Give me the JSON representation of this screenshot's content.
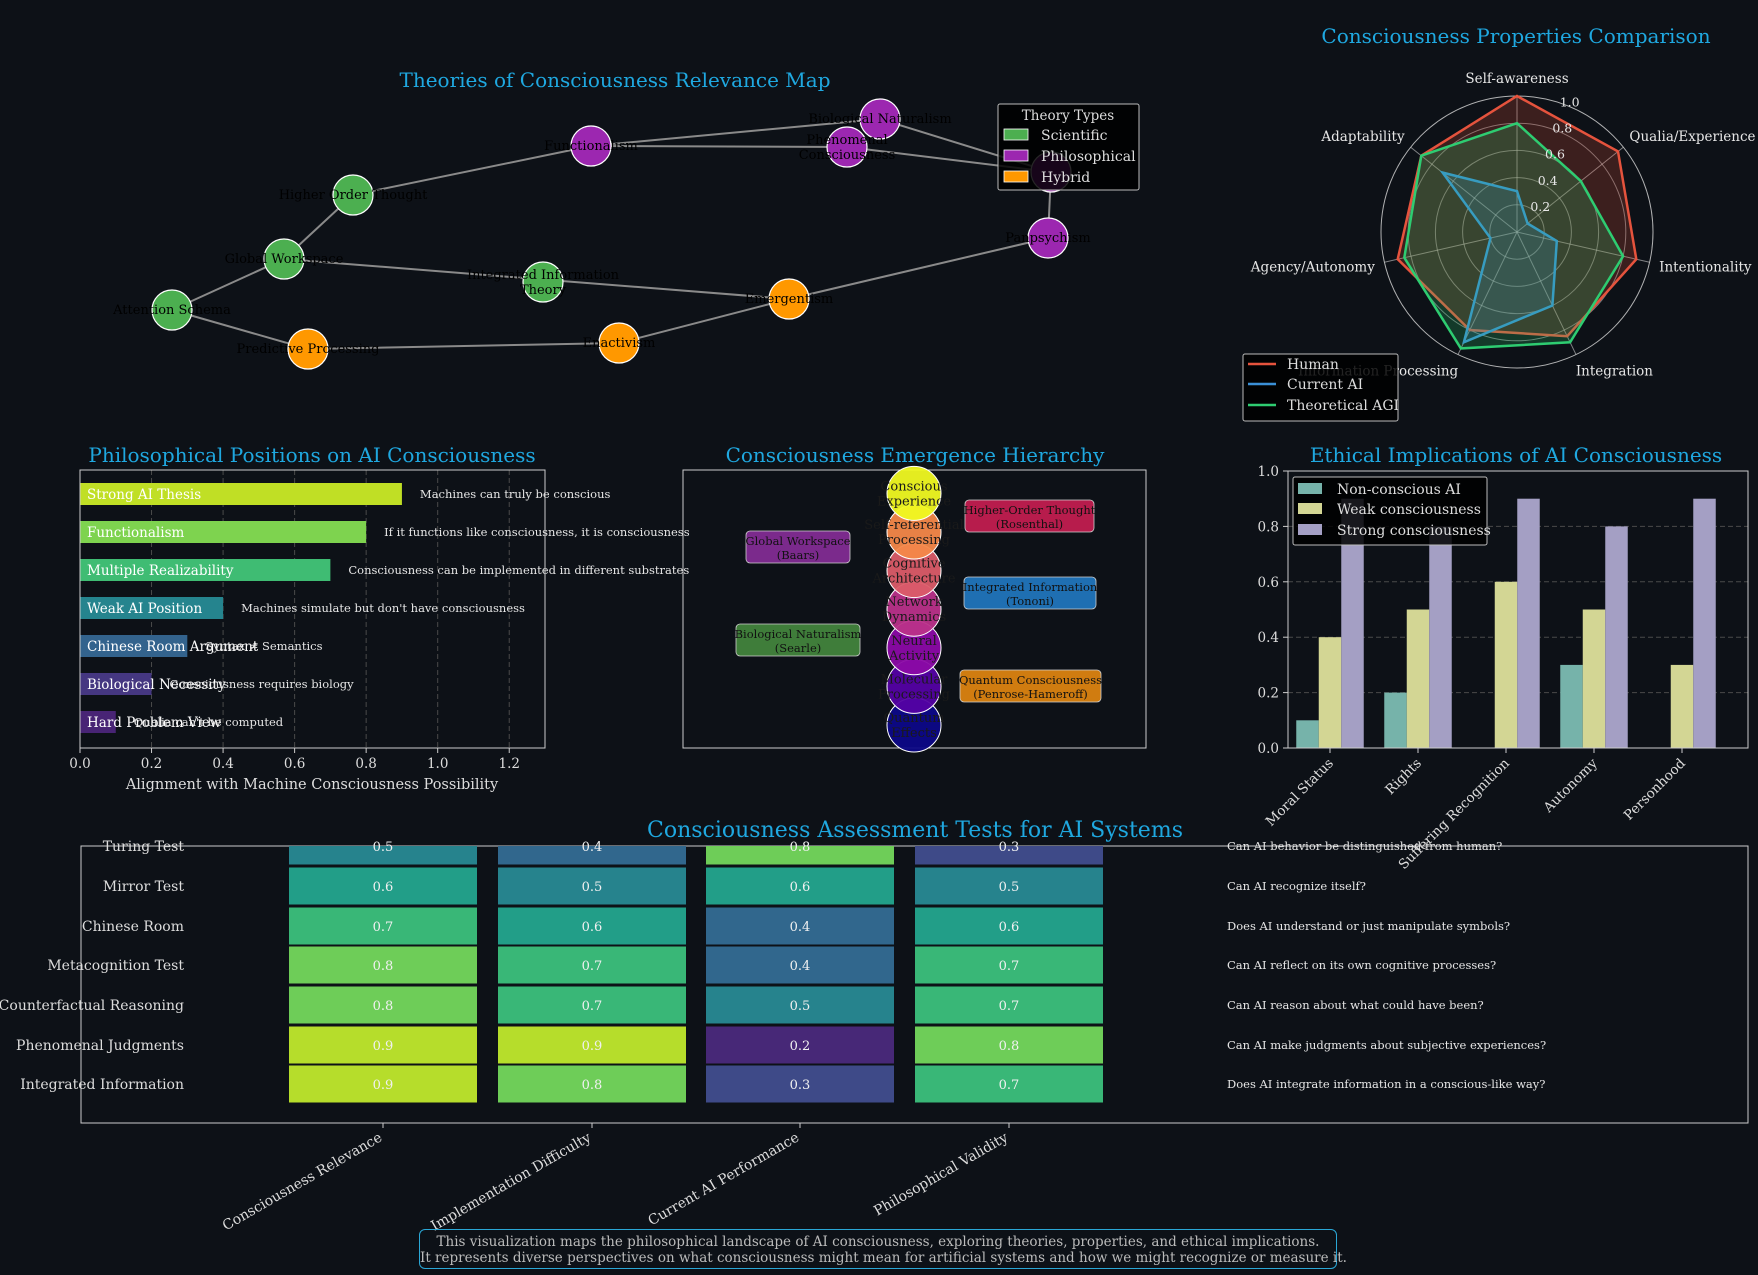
{
  "colors": {
    "background": "#0d1117",
    "title": "#1fa8e0",
    "scientific": "#4caf50",
    "philosophical": "#9c27b0",
    "hybrid": "#ff9800",
    "human": "#e5533d",
    "current_ai": "#3a8fd6",
    "theoretical_agi": "#2ecc71"
  },
  "footer": {
    "line1": "This visualization maps the philosophical landscape of AI consciousness, exploring theories, properties, and ethical implications.",
    "line2": "It represents diverse perspectives on what consciousness might mean for artificial systems and how we might recognize or measure it."
  },
  "chart_data": [
    {
      "id": "theory_map",
      "type": "network",
      "title": "Theories of Consciousness Relevance Map",
      "legend": {
        "title": "Theory Types",
        "placement": "top-right",
        "entries": [
          "Scientific",
          "Philosophical",
          "Hybrid"
        ]
      },
      "nodes": [
        {
          "label": "Attention Schema",
          "kind": "Scientific"
        },
        {
          "label": "Global Workspace",
          "kind": "Scientific"
        },
        {
          "label": "Higher Order Thought",
          "kind": "Scientific"
        },
        {
          "label": "Predictive Processing",
          "kind": "Hybrid"
        },
        {
          "label": "Functionalism",
          "kind": "Philosophical"
        },
        {
          "label": "Integrated Information Theory",
          "kind": "Scientific"
        },
        {
          "label": "Enactivism",
          "kind": "Hybrid"
        },
        {
          "label": "Emergentism",
          "kind": "Hybrid"
        },
        {
          "label": "Phenomenal Consciousness",
          "kind": "Philosophical"
        },
        {
          "label": "Biological Naturalism",
          "kind": "Philosophical"
        },
        {
          "label": "",
          "kind": "Philosophical"
        },
        {
          "label": "Panpsychism",
          "kind": "Philosophical"
        }
      ],
      "edges": [
        [
          0,
          1
        ],
        [
          1,
          2
        ],
        [
          2,
          4
        ],
        [
          4,
          9
        ],
        [
          4,
          8
        ],
        [
          0,
          3
        ],
        [
          3,
          6
        ],
        [
          6,
          7
        ],
        [
          1,
          7
        ],
        [
          7,
          11
        ],
        [
          11,
          10
        ],
        [
          9,
          10
        ],
        [
          8,
          10
        ]
      ]
    },
    {
      "id": "radar",
      "type": "radar",
      "title": "Consciousness Properties Comparison",
      "axes": [
        "Self-awareness",
        "Qualia/Experience",
        "Intentionality",
        "Integration",
        "Information Processing",
        "Agency/Autonomy",
        "Adaptability"
      ],
      "rticks": [
        "0.2",
        "0.4",
        "0.6",
        "0.8",
        "1.0"
      ],
      "rlim": [
        0,
        1
      ],
      "legend_placement": "lower-left",
      "series": [
        {
          "name": "Human",
          "values": [
            1.0,
            0.95,
            0.9,
            0.85,
            0.8,
            0.9,
            0.9
          ]
        },
        {
          "name": "Current AI",
          "values": [
            0.3,
            0.1,
            0.3,
            0.6,
            0.9,
            0.2,
            0.7
          ]
        },
        {
          "name": "Theoretical AGI",
          "values": [
            0.8,
            0.6,
            0.8,
            0.9,
            0.95,
            0.85,
            0.9
          ]
        }
      ]
    },
    {
      "id": "positions",
      "type": "bar",
      "orientation": "horizontal",
      "title": "Philosophical Positions on AI Consciousness",
      "xlabel": "Alignment with Machine Consciousness Possibility",
      "xlim": [
        0,
        1.3
      ],
      "xticks": [
        "0.0",
        "0.2",
        "0.4",
        "0.6",
        "0.8",
        "1.0",
        "1.2"
      ],
      "grid": true,
      "categories": [
        "Strong AI Thesis",
        "Functionalism",
        "Multiple Realizability",
        "Weak AI Position",
        "Chinese Room Argument",
        "Biological Necessity",
        "Hard Problem View"
      ],
      "values": [
        0.9,
        0.8,
        0.7,
        0.4,
        0.3,
        0.2,
        0.1
      ],
      "annotations": [
        "Machines can truly be conscious",
        "If it functions like consciousness, it is consciousness",
        "Consciousness can be implemented in different substrates",
        "Machines simulate but don't have consciousness",
        "Syntax ≠ Semantics",
        "Consciousness requires biology",
        "Qualia can't be computed"
      ],
      "bar_colors": [
        "#c0df25",
        "#7ed34f",
        "#3fbc73",
        "#25848e",
        "#33638d",
        "#453781",
        "#482475"
      ]
    },
    {
      "id": "hierarchy",
      "type": "diagram",
      "title": "Consciousness Emergence Hierarchy",
      "levels": [
        "Quantum Effects",
        "Molecular Processing",
        "Neural Activity",
        "Network Dynamics",
        "Cognitive Architecture",
        "Self-referential Processing",
        "Conscious Experience"
      ],
      "level_colors": [
        "#0d0887",
        "#5402a3",
        "#8b0aa5",
        "#b93289",
        "#db5c68",
        "#f48849",
        "#f0f921"
      ],
      "theories": [
        {
          "label": "Global Workspace",
          "sub": "(Baars)",
          "color": "#7b2a8c"
        },
        {
          "label": "Higher-Order Thought",
          "sub": "(Rosenthal)",
          "color": "#b71c4c"
        },
        {
          "label": "Integrated Information",
          "sub": "(Tononi)",
          "color": "#1f6fb2"
        },
        {
          "label": "Biological Naturalism",
          "sub": "(Searle)",
          "color": "#3f7d3a"
        },
        {
          "label": "Quantum Consciousness",
          "sub": "(Penrose-Hameroff)",
          "color": "#d07c10"
        }
      ]
    },
    {
      "id": "ethics",
      "type": "bar",
      "title": "Ethical Implications of AI Consciousness",
      "categories": [
        "Moral Status",
        "Rights",
        "Suffering Recognition",
        "Autonomy",
        "Personhood"
      ],
      "ylim": [
        0,
        1.0
      ],
      "yticks": [
        "0.0",
        "0.2",
        "0.4",
        "0.6",
        "0.8",
        "1.0"
      ],
      "grid": true,
      "legend_placement": "upper-left",
      "series": [
        {
          "name": "Non-conscious AI",
          "values": [
            0.1,
            0.2,
            0.0,
            0.3,
            0.0
          ],
          "color": "#76b3aa"
        },
        {
          "name": "Weak consciousness",
          "values": [
            0.4,
            0.5,
            0.6,
            0.5,
            0.3
          ],
          "color": "#d3d694"
        },
        {
          "name": "Strong consciousness",
          "values": [
            0.9,
            0.8,
            0.9,
            0.8,
            0.9
          ],
          "color": "#a49fc4"
        }
      ]
    },
    {
      "id": "tests",
      "type": "heatmap",
      "title": "Consciousness Assessment Tests for AI Systems",
      "rows": [
        "Turing Test",
        "Mirror Test",
        "Chinese Room",
        "Metacognition Test",
        "Counterfactual Reasoning",
        "Phenomenal Judgments",
        "Integrated Information"
      ],
      "columns": [
        "Consciousness Relevance",
        "Implementation Difficulty",
        "Current AI Performance",
        "Philosophical Validity"
      ],
      "values": [
        [
          0.5,
          0.4,
          0.8,
          0.3
        ],
        [
          0.6,
          0.5,
          0.6,
          0.5
        ],
        [
          0.7,
          0.6,
          0.4,
          0.6
        ],
        [
          0.8,
          0.7,
          0.4,
          0.7
        ],
        [
          0.8,
          0.7,
          0.5,
          0.7
        ],
        [
          0.9,
          0.9,
          0.2,
          0.8
        ],
        [
          0.9,
          0.8,
          0.3,
          0.7
        ]
      ],
      "questions": [
        "Can AI behavior be distinguished from human?",
        "Can AI recognize itself?",
        "Does AI understand or just manipulate symbols?",
        "Can AI reflect on its own cognitive processes?",
        "Can AI reason about what could have been?",
        "Can AI make judgments about subjective experiences?",
        "Does AI integrate information in a conscious-like way?"
      ]
    }
  ]
}
